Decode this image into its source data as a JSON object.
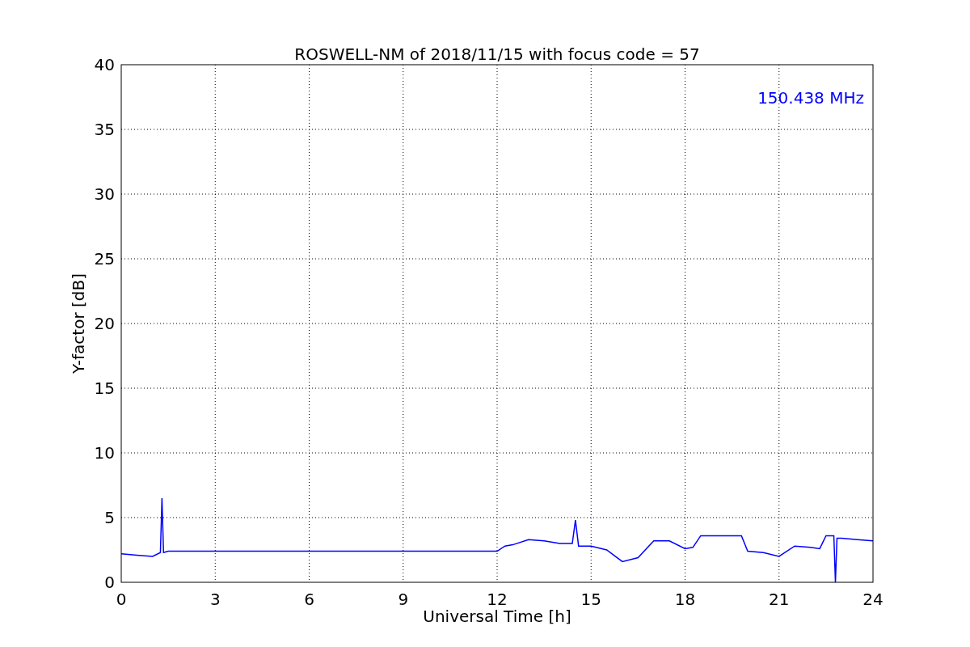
{
  "chart_data": {
    "type": "line",
    "title": "ROSWELL-NM of 2018/11/15 with focus code = 57",
    "xlabel": "Universal Time [h]",
    "ylabel": "Y-factor [dB]",
    "x": [
      0,
      0.5,
      1,
      1.25,
      1.3,
      1.35,
      1.5,
      2,
      3,
      4,
      5,
      6,
      7,
      8,
      9,
      10,
      11,
      12,
      12.25,
      12.5,
      13,
      13.5,
      14,
      14.4,
      14.5,
      14.6,
      15,
      15.5,
      16,
      16.5,
      17,
      17.5,
      18,
      18.25,
      18.5,
      19,
      19.5,
      19.8,
      20,
      20.5,
      21,
      21.5,
      22,
      22.3,
      22.5,
      22.75,
      22.8,
      22.85,
      23,
      23.5,
      24
    ],
    "series": [
      {
        "color": "#0000ff",
        "values": [
          2.2,
          2.1,
          2.0,
          2.3,
          6.5,
          2.3,
          2.4,
          2.4,
          2.4,
          2.4,
          2.4,
          2.4,
          2.4,
          2.4,
          2.4,
          2.4,
          2.4,
          2.4,
          2.8,
          2.9,
          3.3,
          3.2,
          3.0,
          3.0,
          4.8,
          2.8,
          2.8,
          2.5,
          1.6,
          1.9,
          3.2,
          3.2,
          2.6,
          2.7,
          3.6,
          3.6,
          3.6,
          3.6,
          2.4,
          2.3,
          2.0,
          2.8,
          2.7,
          2.6,
          3.6,
          3.6,
          0,
          3.4,
          3.4,
          3.3,
          3.2
        ]
      }
    ],
    "xlim": [
      0,
      24
    ],
    "ylim": [
      0,
      40
    ],
    "xticks": [
      0,
      3,
      6,
      9,
      12,
      15,
      18,
      21,
      24
    ],
    "yticks": [
      0,
      5,
      10,
      15,
      20,
      25,
      30,
      35,
      40
    ],
    "grid": true,
    "annotations": [
      "150.438 MHz"
    ]
  }
}
